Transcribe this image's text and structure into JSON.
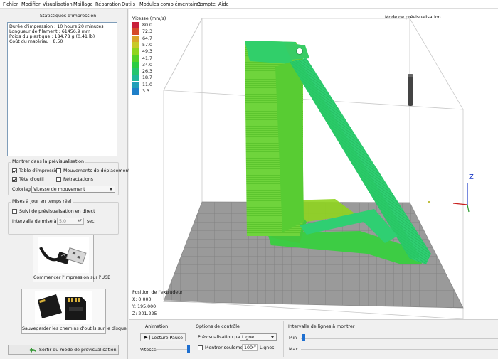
{
  "menu": [
    "Fichier",
    "Modifier",
    "Visualisation",
    "Maillage",
    "Réparation",
    "Outils",
    "Modules complémentaires",
    "Compte",
    "Aide"
  ],
  "stats": {
    "title": "Statistiques d'impression",
    "lines": [
      "Durée d'impression : 10 hours 20 minutes",
      "Longueur de filament : 61456.9 mm",
      "Poids du plastique : 184.78 g (0.41 lb)",
      "Coût du matériau : 8.50"
    ]
  },
  "show": {
    "title": "Montrer dans la prévisualisation",
    "table": {
      "label": "Table d'impression",
      "checked": true
    },
    "moves": {
      "label": "Mouvements de déplacement",
      "checked": false
    },
    "tool": {
      "label": "Tête d'outil",
      "checked": true
    },
    "retract": {
      "label": "Rétractations",
      "checked": false
    },
    "color_label": "Coloriage",
    "color_value": "Vitesse de mouvement"
  },
  "realtime": {
    "title": "Mises à jour en temps réel",
    "follow": {
      "label": "Suivi de prévisualisation en direct",
      "checked": false
    },
    "interval_label": "Intervalle de mise à jour",
    "interval_value": "5.0",
    "interval_unit": "sec"
  },
  "usb_button": "Commencer l'impression sur l'USB",
  "sd_button": "Sauvegarder les chemins d'outils sur le disque",
  "exit_button": "Sortir du mode de prévisualisation",
  "viewport": {
    "mode": "Mode de prévisualisation",
    "legend_title": "Vitesse (mm/s)",
    "legend": [
      {
        "value": "80.0",
        "color": "#c8203a"
      },
      {
        "value": "72.3",
        "color": "#d54a2a"
      },
      {
        "value": "64.7",
        "color": "#d9a52b"
      },
      {
        "value": "57.0",
        "color": "#c7c92a"
      },
      {
        "value": "49.3",
        "color": "#8fd41f"
      },
      {
        "value": "41.7",
        "color": "#54d128"
      },
      {
        "value": "34.0",
        "color": "#2bcc44"
      },
      {
        "value": "26.3",
        "color": "#25c46e"
      },
      {
        "value": "18.7",
        "color": "#22b79a"
      },
      {
        "value": "11.0",
        "color": "#209fb9"
      },
      {
        "value": "3.3",
        "color": "#1e7fc8"
      }
    ],
    "extruder_title": "Position de l'extrudeur",
    "x": "X: 0.000",
    "y": "Y: 195.000",
    "z": "Z: 201.225"
  },
  "animation": {
    "title": "Animation",
    "play": "Lecture,Pause",
    "speed_label": "Vitesse"
  },
  "options": {
    "title": "Options de contrôle",
    "preview_by_label": "Prévisualisation par",
    "preview_by_value": "Ligne",
    "show_only_label": "Montrer seulement",
    "show_only_value": "100",
    "lines_unit": "Lignes"
  },
  "range": {
    "title": "Intervalle de lignes à montrer",
    "min_label": "Min",
    "max_label": "Max"
  }
}
